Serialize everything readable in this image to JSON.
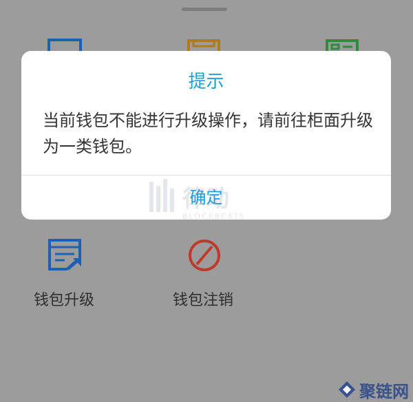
{
  "dialog": {
    "title": "提示",
    "message": "当前钱包不能进行升级操作，请前往柜面升级为一类钱包。",
    "confirm_label": "确定"
  },
  "menu": {
    "items": [
      {
        "label": "钱包升级",
        "icon": "wallet-upgrade-icon"
      },
      {
        "label": "钱包注销",
        "icon": "wallet-cancel-icon"
      }
    ]
  },
  "watermarks": {
    "dialog_mark": "律动",
    "dialog_mark_sub": "BLOCKBEATS",
    "corner_mark": "聚链网"
  },
  "colors": {
    "accent": "#1aa0e0",
    "upgrade_icon": "#1f5fb0",
    "cancel_icon": "#c0392b"
  }
}
